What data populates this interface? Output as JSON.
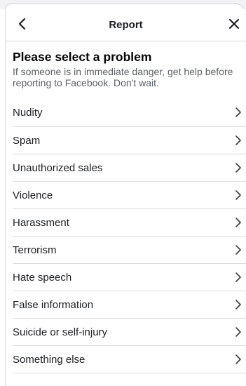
{
  "header": {
    "title": "Report",
    "back_icon": "chevron-left-icon",
    "close_icon": "close-icon"
  },
  "intro": {
    "heading": "Please select a problem",
    "subtext": "If someone is in immediate danger, get help before reporting to Facebook. Don't wait."
  },
  "problems": [
    {
      "label": "Nudity"
    },
    {
      "label": "Spam"
    },
    {
      "label": "Unauthorized sales"
    },
    {
      "label": "Violence"
    },
    {
      "label": "Harassment"
    },
    {
      "label": "Terrorism"
    },
    {
      "label": "Hate speech"
    },
    {
      "label": "False information"
    },
    {
      "label": "Suicide or self-injury"
    },
    {
      "label": "Something else"
    }
  ],
  "colors": {
    "text_primary": "#1c1e21",
    "text_secondary": "#5c5f63",
    "divider": "#dcdcdf"
  }
}
